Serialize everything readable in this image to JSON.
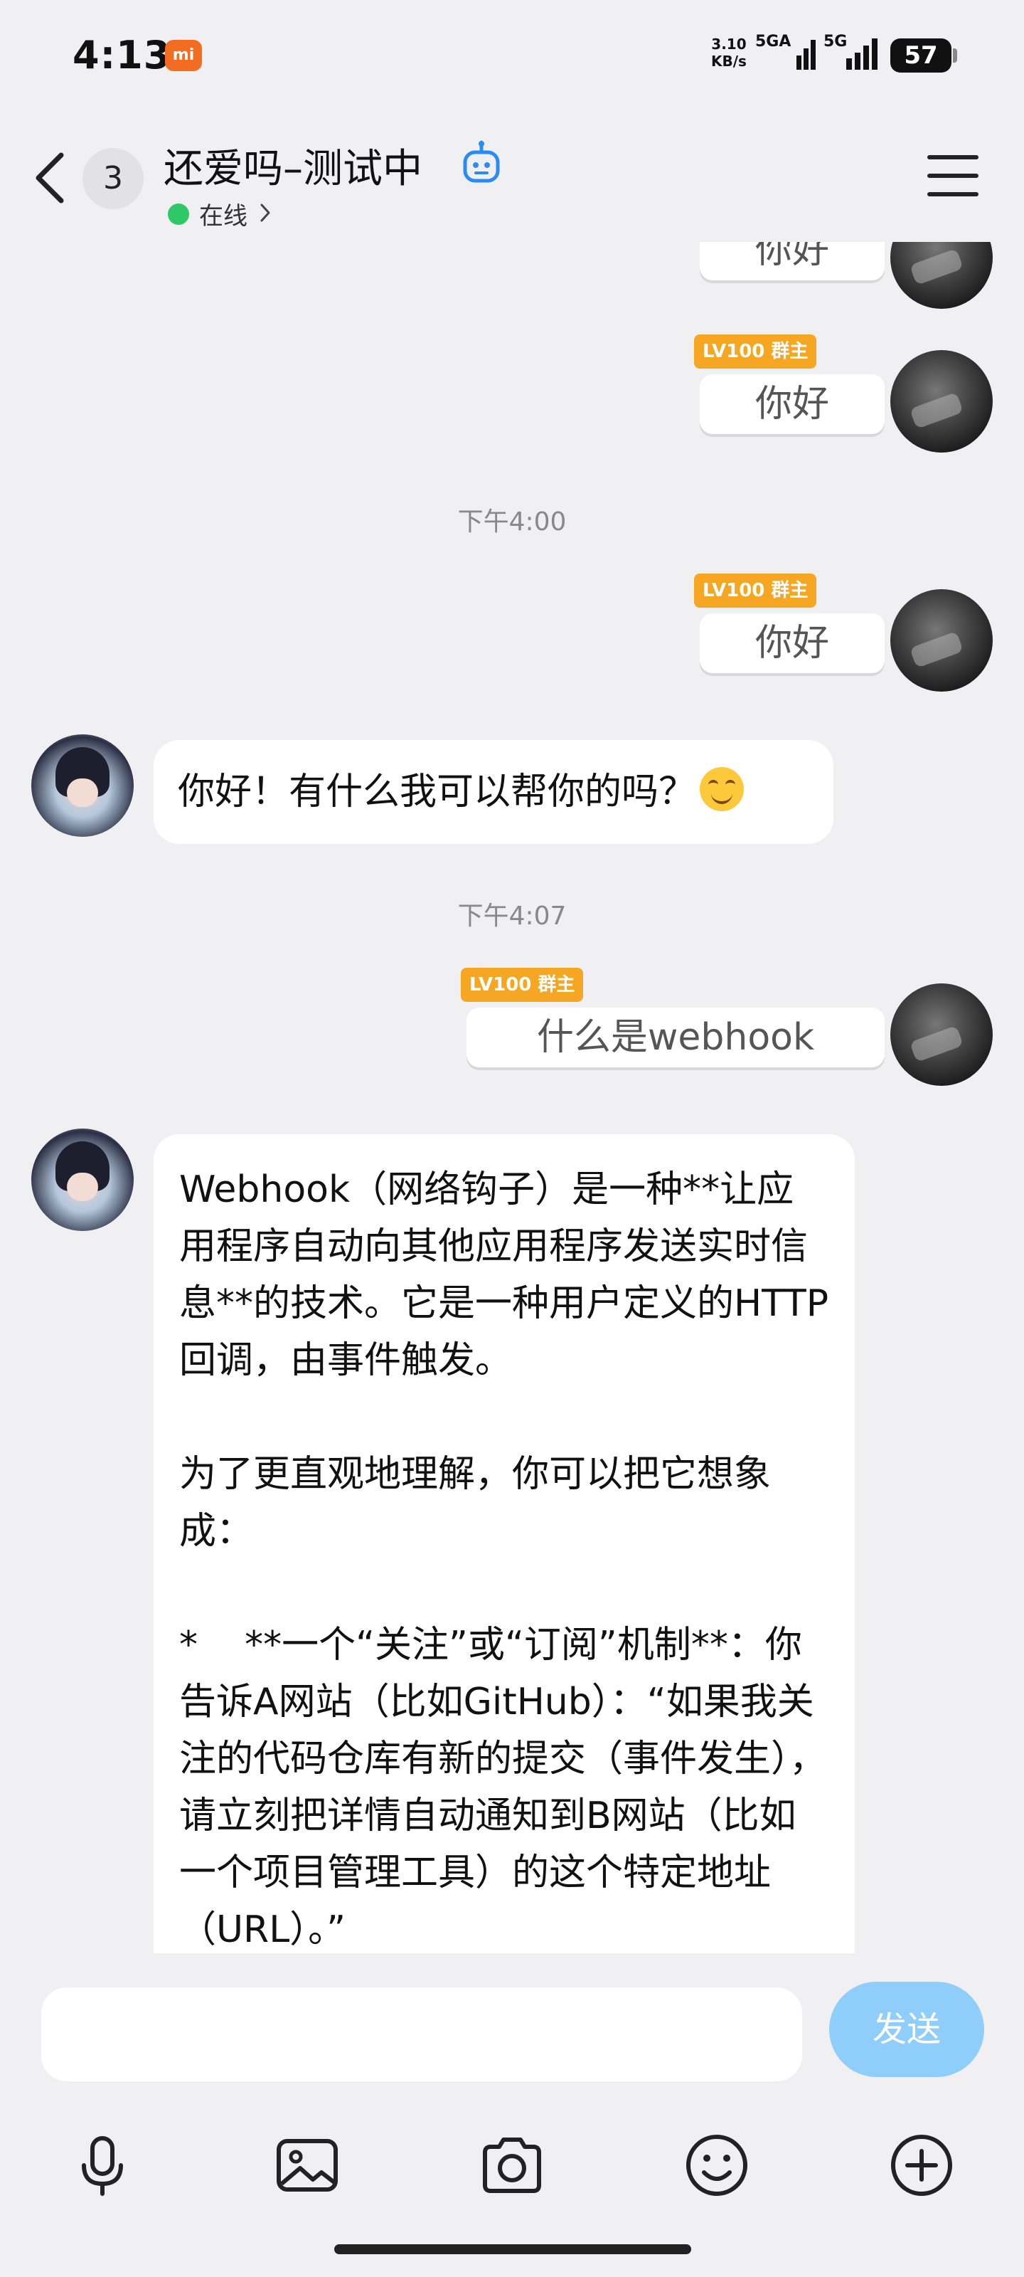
{
  "status_bar": {
    "time": "4:13",
    "brand_badge": "mi",
    "net_speed_value": "3.10",
    "net_speed_unit": "KB/s",
    "sim1_label": "5GA",
    "sim2_label": "5G",
    "battery": "57"
  },
  "header": {
    "unread_count": "3",
    "title": "还爱吗–测试中",
    "status": "在线"
  },
  "messages": {
    "m1_text": "你好",
    "m2_badge": "LV100 群主",
    "m2_text": "你好",
    "ts1": "下午4:00",
    "m3_badge": "LV100 群主",
    "m3_text": "你好",
    "m4_text": "你好！有什么我可以帮你的吗？",
    "ts2": "下午4:07",
    "m5_badge": "LV100 群主",
    "m5_text": "什么是webhook",
    "m6_text": "Webhook（网络钩子）是一种**让应用程序自动向其他应用程序发送实时信息**的技术。它是一种用户定义的HTTP回调，由事件触发。\n\n为了更直观地理解，你可以把它想象成：\n\n*    **一个“关注”或“订阅”机制**：你告诉A网站（比如GitHub）：“如果我关注的代码仓库有新的提交（事件发生），请立刻把详情自动通知到B网站（比如一个项目管理工具）的这个特定地址（URL）。”"
  },
  "input": {
    "placeholder": "",
    "send_label": "发送"
  },
  "colors": {
    "accent": "#8fcdfa",
    "online": "#2fc866",
    "badge": "#f5a623"
  }
}
